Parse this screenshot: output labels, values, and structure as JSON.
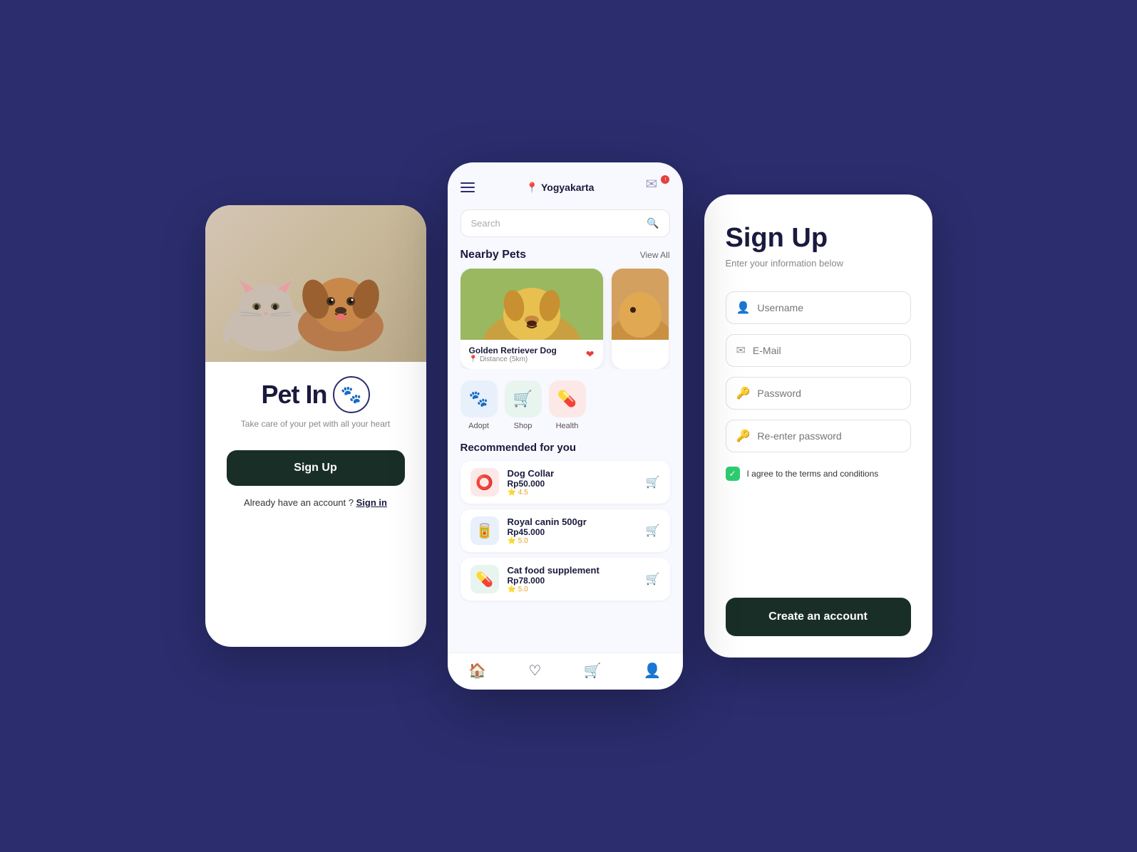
{
  "background": {
    "color": "#2b2d6e"
  },
  "screen1": {
    "app_name": "Pet In",
    "tagline": "Take care of your pet with all your heart",
    "signup_button": "Sign Up",
    "signin_prompt": "Already have an account ?",
    "signin_link": "Sign in"
  },
  "screen2": {
    "location": "Yogyakarta",
    "search_placeholder": "Search",
    "nearby_section": "Nearby Pets",
    "view_all": "View All",
    "pet1_name": "Golden Retriever Dog",
    "pet1_distance": "Distance (5km)",
    "categories": [
      {
        "label": "Adopt",
        "emoji": "🐾",
        "bg": "adopt"
      },
      {
        "label": "Shop",
        "emoji": "🛍️",
        "bg": "shop"
      },
      {
        "label": "Health",
        "emoji": "💊",
        "bg": "health"
      }
    ],
    "recommended_title": "Recommended for you",
    "products": [
      {
        "name": "Dog Collar",
        "price": "Rp50.000",
        "rating": "⭐ 4.5",
        "emoji": "🔴"
      },
      {
        "name": "Royal canin 500gr",
        "price": "Rp45.000",
        "rating": "⭐ 5.0",
        "emoji": "🟦"
      },
      {
        "name": "Cat food supplement",
        "price": "Rp78.000",
        "rating": "⭐ 5.0",
        "emoji": "🟩"
      }
    ]
  },
  "screen3": {
    "title": "Sign Up",
    "subtitle": "Enter your information below",
    "username_placeholder": "Username",
    "email_placeholder": "E-Mail",
    "password_placeholder": "Password",
    "reenter_placeholder": "Re-enter password",
    "terms_text": "I agree to the terms and conditions",
    "create_button": "Create an account"
  }
}
